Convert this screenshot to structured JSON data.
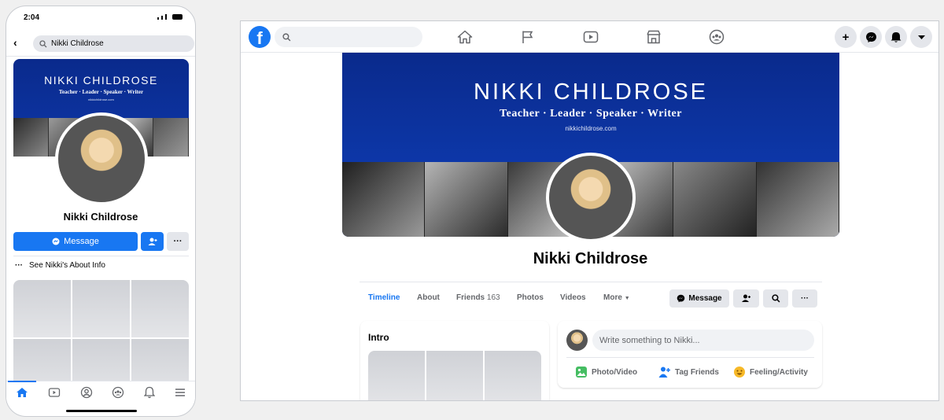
{
  "phone": {
    "time": "2:04",
    "search_value": "Nikki Childrose",
    "cover": {
      "name": "NIKKI CHILDROSE",
      "tagline": "Teacher · Leader · Speaker · Writer",
      "url": "nikkichildrose.com"
    },
    "profile_name": "Nikki Childrose",
    "message_label": "Message",
    "about_label": "See Nikki's About Info",
    "tabbar_icons": [
      "home-icon",
      "watch-icon",
      "profile-icon",
      "groups-icon",
      "notifications-icon",
      "menu-icon"
    ]
  },
  "browser": {
    "nav_icons": [
      "home-icon",
      "pages-flag-icon",
      "watch-icon",
      "marketplace-icon",
      "groups-icon"
    ],
    "right_icons": [
      "create-plus-icon",
      "messenger-icon",
      "notifications-icon",
      "account-caret-icon"
    ],
    "cover": {
      "name": "NIKKI CHILDROSE",
      "tagline": "Teacher · Leader · Speaker · Writer",
      "url": "nikkichildrose.com"
    },
    "profile_name": "Nikki Childrose",
    "tabs": {
      "timeline": "Timeline",
      "about": "About",
      "friends": "Friends",
      "friends_count": "163",
      "photos": "Photos",
      "videos": "Videos",
      "more": "More"
    },
    "actions": {
      "message": "Message"
    },
    "intro_title": "Intro",
    "composer": {
      "placeholder": "Write something to Nikki...",
      "photo_video": "Photo/Video",
      "tag_friends": "Tag Friends",
      "feeling_activity": "Feeling/Activity"
    }
  },
  "colors": {
    "brand_blue": "#1877f2",
    "cover_blue": "#0d37a8",
    "gray_button": "#e4e6eb"
  }
}
